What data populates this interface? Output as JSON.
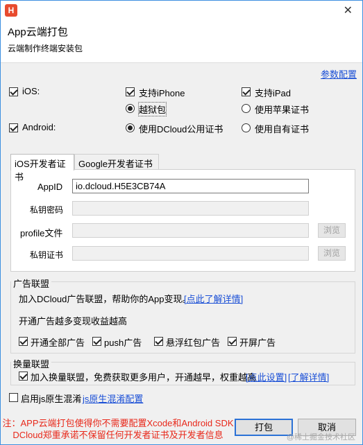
{
  "window": {
    "app_icon_letter": "H",
    "close_glyph": "✕"
  },
  "header": {
    "title": "App云端打包",
    "subtitle": "云端制作终端安装包"
  },
  "params_link": "参数配置",
  "platforms": {
    "ios": {
      "label": "iOS:",
      "checked": true
    },
    "iphone": {
      "label": "支持iPhone",
      "checked": true
    },
    "ipad": {
      "label": "支持iPad",
      "checked": true
    },
    "jailbreak": {
      "label": "越狱包",
      "selected": true
    },
    "apple_cert": {
      "label": "使用苹果证书",
      "selected": false
    },
    "android": {
      "label": "Android:",
      "checked": true
    },
    "dcloud_cert": {
      "label": "使用DCloud公用证书",
      "selected": true
    },
    "own_cert": {
      "label": "使用自有证书",
      "selected": false
    }
  },
  "tabs": [
    {
      "label": "iOS开发者证书",
      "active": true
    },
    {
      "label": "Google开发者证书",
      "active": false
    }
  ],
  "cert_form": {
    "appid_label": "AppID",
    "appid_value": "io.dcloud.H5E3CB74A",
    "key_password_label": "私钥密码",
    "profile_label": "profile文件",
    "private_cert_label": "私钥证书",
    "browse_label": "浏览"
  },
  "ad_union": {
    "title": "广告联盟",
    "description": "加入DCloud广告联盟，帮助你的App变现。",
    "learn_more": "[点此了解详情]",
    "hint": "开通广告越多变现收益越高",
    "options": [
      {
        "label": "开通全部广告",
        "checked": true
      },
      {
        "label": "push广告",
        "checked": true
      },
      {
        "label": "悬浮红包广告",
        "checked": true
      },
      {
        "label": "开屏广告",
        "checked": true
      }
    ]
  },
  "swap_union": {
    "title": "换量联盟",
    "label": "加入换量联盟，免费获取更多用户，开通越早，权重越高",
    "checked": true,
    "settings_link": "[点此设置]",
    "details_link": "[了解详情]"
  },
  "obfuscation": {
    "label": "启用js原生混淆",
    "checked": false,
    "config_link": "js原生混淆配置"
  },
  "footer": {
    "note_line1": "注：APP云端打包使得你不需要配置Xcode和Android SDK",
    "note_line2": "DCloud郑重承诺不保留任何开发者证书及开发者信息",
    "pack_button": "打包",
    "cancel_button": "取消"
  },
  "watermark": "@稀土掘金技术社区",
  "colors": {
    "link": "#1a4fd6",
    "note": "#e8281a",
    "border": "#3c8fe0"
  }
}
